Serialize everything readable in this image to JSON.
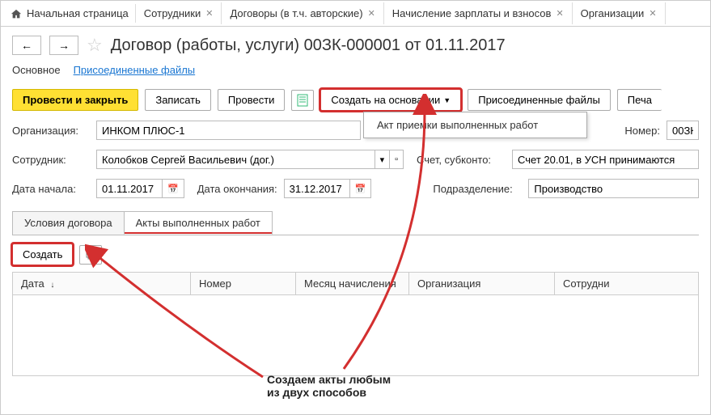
{
  "tabs": {
    "home": "Начальная страница",
    "items": [
      {
        "label": "Сотрудники"
      },
      {
        "label": "Договоры (в т.ч. авторские)"
      },
      {
        "label": "Начисление зарплаты и взносов"
      },
      {
        "label": "Организации"
      }
    ]
  },
  "title": "Договор (работы, услуги) 00ЗК-000001 от 01.11.2017",
  "sections": {
    "main": "Основное",
    "files": "Присоединенные файлы"
  },
  "toolbar": {
    "post_close": "Провести и закрыть",
    "save": "Записать",
    "post": "Провести",
    "create_based": "Создать на основании",
    "attached": "Присоединенные файлы",
    "print": "Печа"
  },
  "dropdown": {
    "item": "Акт приемки выполненных работ"
  },
  "form": {
    "org_label": "Организация:",
    "org_value": "ИНКОМ ПЛЮС-1",
    "number_label": "Номер:",
    "number_value": "00ЗК",
    "employee_label": "Сотрудник:",
    "employee_value": "Колобков Сергей Васильевич (дог.)",
    "account_label": "Счет, субконто:",
    "account_value": "Счет 20.01, в УСН принимаются",
    "start_label": "Дата начала:",
    "start_value": "01.11.2017",
    "end_label": "Дата окончания:",
    "end_value": "31.12.2017",
    "dept_label": "Подразделение:",
    "dept_value": "Производство"
  },
  "subtabs": {
    "terms": "Условия договора",
    "acts": "Акты выполненных работ"
  },
  "subtoolbar": {
    "create": "Создать"
  },
  "table": {
    "cols": [
      "Дата",
      "Номер",
      "Месяц начисления",
      "Организация",
      "Сотрудни"
    ]
  },
  "annotation": {
    "line1": "Создаем акты любым",
    "line2": "из двух способов"
  }
}
